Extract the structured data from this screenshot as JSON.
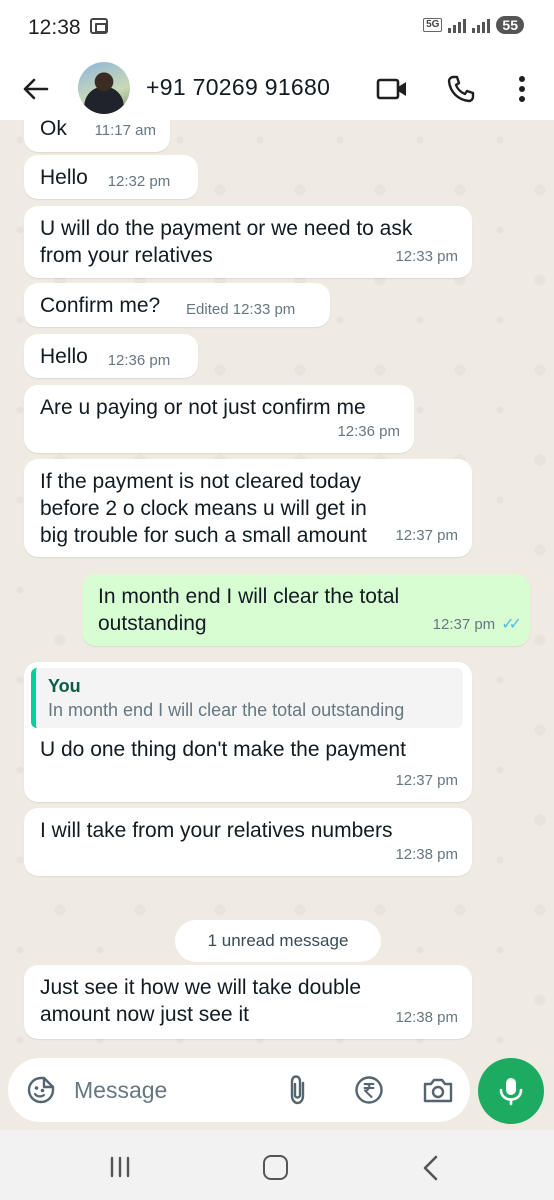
{
  "status_bar": {
    "time": "12:38",
    "network": "5G",
    "battery": "55"
  },
  "header": {
    "contact": "+91 70269 91680"
  },
  "messages": [
    {
      "text": "Ok",
      "time": "11:17 am"
    },
    {
      "text": "Hello",
      "time": "12:32 pm"
    },
    {
      "text": "U will do the payment or we need to ask from your relatives",
      "time": "12:33 pm"
    },
    {
      "text": "Confirm me?",
      "time": "Edited 12:33 pm"
    },
    {
      "text": "Hello",
      "time": "12:36 pm"
    },
    {
      "text": "Are u paying or not just confirm me",
      "time": "12:36 pm"
    },
    {
      "text": "If the payment is not cleared today before 2 o clock means u will get in big trouble for such a small amount",
      "time": "12:37 pm"
    },
    {
      "text": "In month end I will clear the total outstanding",
      "time": "12:37 pm",
      "outgoing": true,
      "status": "read"
    },
    {
      "quote_author": "You",
      "quote_text": "In month end I will clear the total outstanding",
      "text": "U do one thing don't make the payment",
      "time": "12:37 pm"
    },
    {
      "text": "I will take from your relatives numbers",
      "time": "12:38 pm"
    },
    {
      "text": "Just see it how we will take double amount now just see it",
      "time": "12:38 pm"
    }
  ],
  "unread_label": "1 unread message",
  "composer": {
    "placeholder": "Message"
  },
  "colors": {
    "accent": "#1daa61",
    "outgoing_bubble": "#d9fdd3",
    "chat_background": "#efeae2",
    "read_tick": "#53bdeb"
  }
}
